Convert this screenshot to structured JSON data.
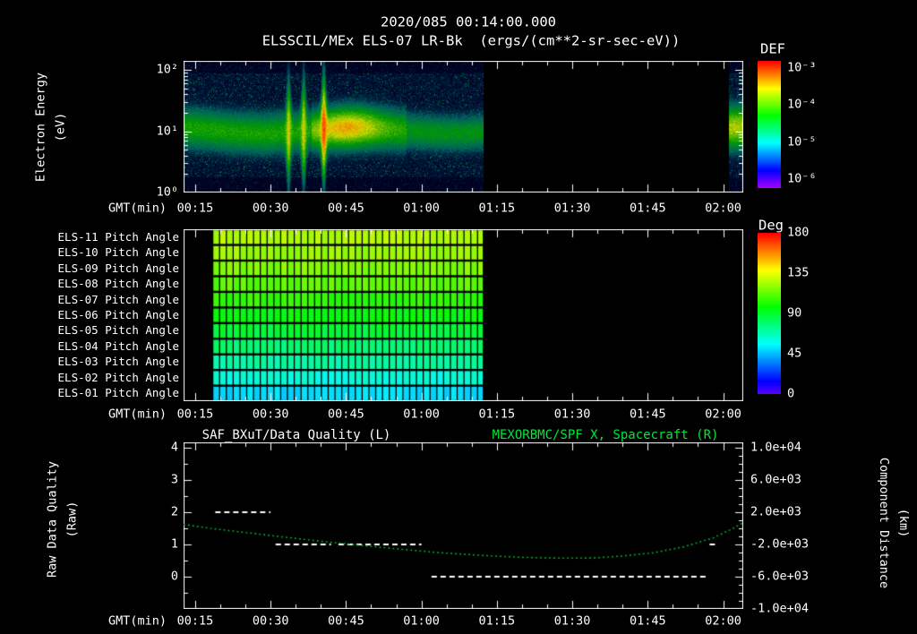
{
  "colors": {
    "background": "#000000",
    "foreground": "#ffffff",
    "green_label": "#00e839",
    "green_curve": "#00b332"
  },
  "header": {
    "timestamp": "2020/085 00:14:00.000",
    "title": "ELSSCIL/MEx ELS-07 LR-Bk  (ergs/(cm**2-sr-sec-eV))"
  },
  "time_axis": {
    "label": "GMT(min)",
    "ticks": [
      "00:15",
      "00:30",
      "00:45",
      "01:00",
      "01:15",
      "01:30",
      "01:45",
      "02:00"
    ],
    "tick_minutes": [
      15,
      30,
      45,
      60,
      75,
      90,
      105,
      120
    ],
    "range_minutes": [
      12.7,
      124
    ]
  },
  "panels": {
    "spectrogram": {
      "ylabel_line1": "Electron Energy",
      "ylabel_line2": "(eV)",
      "colorbar_title": "DEF"
    },
    "pitch": {
      "colorbar_title": "Deg"
    },
    "lineplot": {
      "title_left": "SAF_BXuT/Data Quality (L)",
      "title_right": "MEXORBMC/SPF X, Spacecraft (R)",
      "ylabel_left_line1": "Raw Data Quality",
      "ylabel_left_line2": "(Raw)",
      "ylabel_right_line1": "Component Distance",
      "ylabel_right_line2": "(km)",
      "y_tick_labels_left": [
        "4",
        "3",
        "2",
        "1",
        "0"
      ],
      "y_tick_labels_right": [
        "1.0e+04",
        "6.0e+03",
        "2.0e+03",
        "-2.0e+03",
        "-6.0e+03",
        "-1.0e+04"
      ]
    }
  },
  "chart_data": [
    {
      "type": "heatmap",
      "name": "electron-energy-spectrogram",
      "title": "ELSSCIL/MEx ELS-07 LR-Bk",
      "units": "ergs/(cm**2-sr-sec-eV)",
      "x_axis": {
        "label": "GMT(min)",
        "range_minutes": [
          12.7,
          124
        ],
        "tick_minutes": [
          15,
          30,
          45,
          60,
          75,
          90,
          105,
          120
        ]
      },
      "y_axis": {
        "label": "Electron Energy (eV)",
        "scale": "log",
        "log_range": [
          0,
          2.15
        ],
        "tick_decades": [
          2,
          1,
          0
        ],
        "tick_labels": [
          "10²",
          "10¹",
          "10⁰"
        ]
      },
      "color_axis": {
        "label": "DEF",
        "scale": "log",
        "tick_labels": [
          "10⁻³",
          "10⁻⁴",
          "10⁻⁵",
          "10⁻⁶"
        ],
        "top_value": "10⁻³",
        "bottom_value": "10⁻⁶"
      },
      "coverage_minutes": [
        [
          12.7,
          72.3
        ],
        [
          121,
          124
        ]
      ],
      "features": {
        "band_center_ev": 10,
        "band_sigma_decades": 0.28,
        "enhancement_minutes": [
          38,
          57
        ],
        "enhancement_peak_minute": 45,
        "spike_minutes": [
          33.5,
          36.5,
          40.5
        ],
        "background": "blue speckle noise near 10⁻⁶",
        "band_peak": "green-yellow near 10⁻⁴"
      }
    },
    {
      "type": "heatmap",
      "name": "pitch-angle-panels",
      "coverage_minutes": [
        18.5,
        72.3
      ],
      "cell_minutes": 1.35,
      "color_axis": {
        "label": "Deg",
        "min": 0,
        "max": 180,
        "tick_values": [
          180,
          135,
          90,
          45,
          0
        ],
        "tick_labels": [
          "180",
          "135",
          "90",
          "45",
          "0"
        ]
      },
      "rows": [
        {
          "label": "ELS-11 Pitch Angle",
          "mean_deg": 126
        },
        {
          "label": "ELS-10 Pitch Angle",
          "mean_deg": 122
        },
        {
          "label": "ELS-09 Pitch Angle",
          "mean_deg": 118
        },
        {
          "label": "ELS-08 Pitch Angle",
          "mean_deg": 112
        },
        {
          "label": "ELS-07 Pitch Angle",
          "mean_deg": 104
        },
        {
          "label": "ELS-06 Pitch Angle",
          "mean_deg": 96
        },
        {
          "label": "ELS-05 Pitch Angle",
          "mean_deg": 88
        },
        {
          "label": "ELS-04 Pitch Angle",
          "mean_deg": 79
        },
        {
          "label": "ELS-03 Pitch Angle",
          "mean_deg": 70
        },
        {
          "label": "ELS-02 Pitch Angle",
          "mean_deg": 60
        },
        {
          "label": "ELS-01 Pitch Angle",
          "mean_deg": 50
        }
      ]
    },
    {
      "type": "line",
      "name": "data-quality-and-spacecraft-x",
      "left_axis": {
        "label": "Raw Data Quality (Raw)",
        "tick_values": [
          4,
          3,
          2,
          1,
          0
        ]
      },
      "right_axis": {
        "label": "Component Distance (km)",
        "tick_values": [
          10000,
          6000,
          2000,
          -2000,
          -6000,
          -10000
        ]
      },
      "series": [
        {
          "name": "SAF_BXuT/Data Quality (L)",
          "axis": "left",
          "style": "dashed",
          "color": "#ffffff",
          "segments": [
            {
              "value": 2,
              "start_min": 19,
              "end_min": 30
            },
            {
              "value": 1,
              "start_min": 31,
              "end_min": 42
            },
            {
              "value": 1,
              "start_min": 43.5,
              "end_min": 60
            },
            {
              "value": 0,
              "start_min": 62,
              "end_min": 116.5
            },
            {
              "value": 1,
              "start_min": 117.3,
              "end_min": 118.8
            }
          ]
        },
        {
          "name": "MEXORBMC/SPF X, Spacecraft (R)",
          "axis": "right",
          "style": "dotted",
          "color": "#00b332",
          "points_min_km": [
            [
              12.7,
              480
            ],
            [
              18,
              0
            ],
            [
              25,
              -520
            ],
            [
              32,
              -1040
            ],
            [
              40,
              -1600
            ],
            [
              48,
              -2120
            ],
            [
              56,
              -2600
            ],
            [
              64,
              -3040
            ],
            [
              72,
              -3360
            ],
            [
              80,
              -3600
            ],
            [
              88,
              -3700
            ],
            [
              94,
              -3680
            ],
            [
              100,
              -3440
            ],
            [
              106,
              -3040
            ],
            [
              112,
              -2320
            ],
            [
              118,
              -1200
            ],
            [
              122,
              0
            ],
            [
              124,
              720
            ]
          ]
        }
      ]
    }
  ]
}
